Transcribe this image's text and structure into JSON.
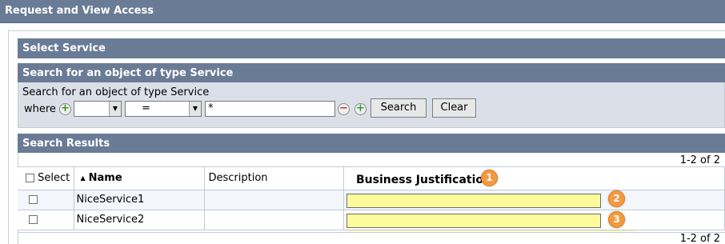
{
  "title_bar": {
    "title": "Request and View Access"
  },
  "sections": {
    "select_service": "Select Service",
    "search_header": "Search for an object of type Service",
    "search_results": "Search Results"
  },
  "search": {
    "label": "Search for an object of type Service",
    "where_label": "where",
    "field_value": "",
    "operator_value": "=",
    "query_value": "*",
    "search_button": "Search",
    "clear_button": "Clear"
  },
  "pager": {
    "top": "1-2 of 2",
    "bottom": "1-2 of 2"
  },
  "table": {
    "columns": {
      "select": "Select",
      "name": "Name",
      "description": "Description",
      "business_justification": "Business Justification"
    },
    "rows": [
      {
        "name": "NiceService1",
        "description": "",
        "justification": ""
      },
      {
        "name": "NiceService2",
        "description": "",
        "justification": ""
      }
    ]
  },
  "annotations": {
    "badge1": "1",
    "badge2": "2",
    "badge3": "3"
  },
  "colors": {
    "header_bg": "#6a7b95",
    "highlight": "#f6f78a",
    "badge": "#f39a40"
  }
}
